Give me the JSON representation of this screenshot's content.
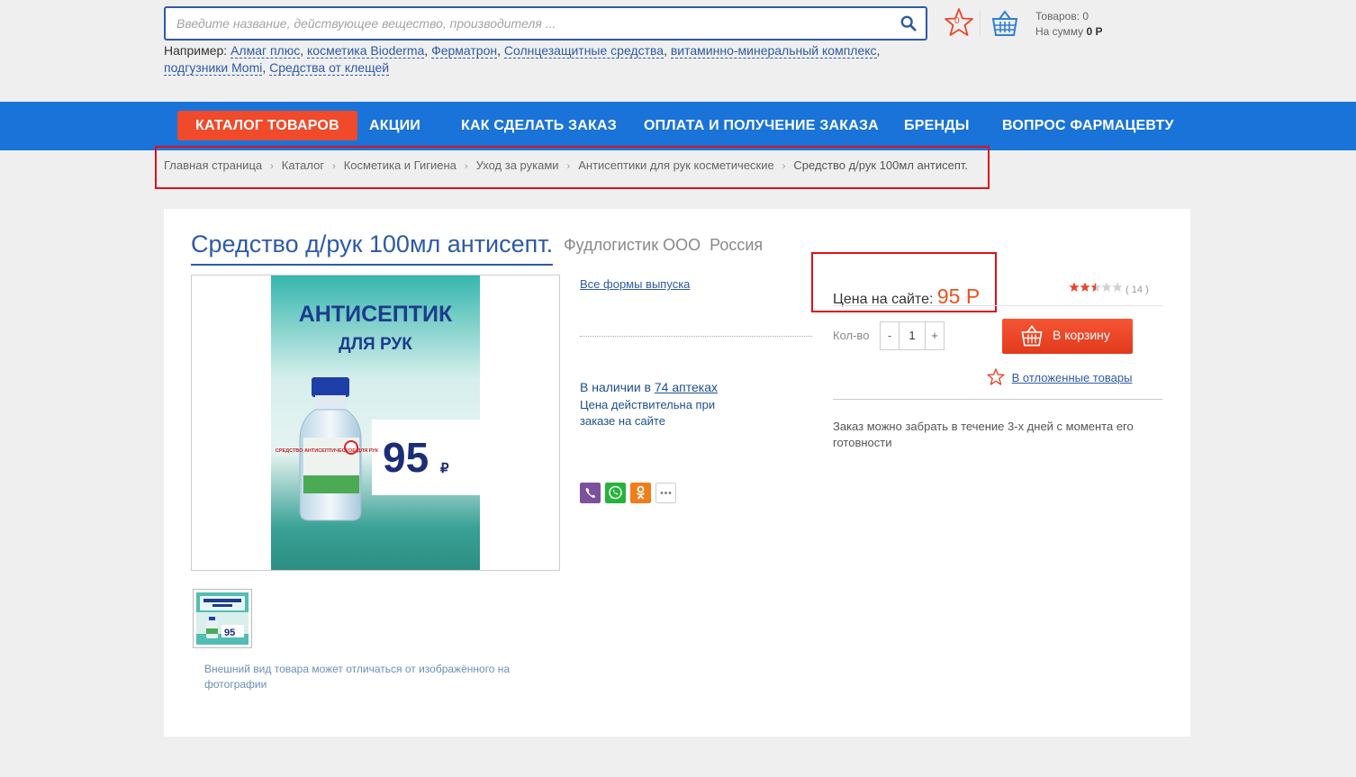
{
  "search": {
    "placeholder": "Введите название, действующее вещество, производителя ..."
  },
  "examples": {
    "prefix": "Например:",
    "items": [
      "Алмаг плюс",
      "косметика Bioderma",
      "Ферматрон",
      "Солнцезащитные средства",
      "витаминно-минеральный комплекс",
      "подгузники Momi",
      "Средства от клещей"
    ]
  },
  "header": {
    "favorites_count": "0",
    "cart_items": "Товаров: 0",
    "cart_sum_label": "На сумму",
    "cart_sum_value": "0 Р"
  },
  "nav": [
    "КАТАЛОГ ТОВАРОВ",
    "АКЦИИ",
    "КАК СДЕЛАТЬ ЗАКАЗ",
    "ОПЛАТА И ПОЛУЧЕНИЕ ЗАКАЗА",
    "БРЕНДЫ",
    "ВОПРОС ФАРМАЦЕВТУ"
  ],
  "breadcrumb": [
    "Главная страница",
    "Каталог",
    "Косметика и Гигиена",
    "Уход за руками",
    "Антисептики для рук косметические",
    "Средство д/рук 100мл антисепт."
  ],
  "product": {
    "title": "Средство д/рук 100мл антисепт.",
    "manufacturer": "Фудлогистик ООО",
    "country": "Россия",
    "image_text_line1": "АНТИСЕПТИК",
    "image_text_line2": "ДЛЯ РУК",
    "image_price": "95",
    "image_currency": "₽",
    "image_bottle_label": "СРЕДСТВО АНТИСЕПТИЧЕСКОЕ ДЛЯ РУК",
    "thumb_price": "95",
    "disclaimer": "Внешний вид товара может отличаться от изображённого на фотографии",
    "all_forms_link": "Все формы выпуска",
    "stock_prefix": "В наличии в",
    "stock_link": "74 аптеках",
    "stock_note": "Цена действительна при заказе на сайте",
    "price_label": "Цена на сайте:",
    "price_value": "95 Р",
    "rating": 2.5,
    "rating_count": "( 14 )",
    "qty_label": "Кол-во",
    "qty_minus": "-",
    "qty_value": "1",
    "qty_plus": "+",
    "cart_button": "В корзину",
    "deferred_link": "В отложенные товары",
    "pickup_note": "Заказ можно забрать в течение 3-х дней с момента его готовности"
  },
  "colors": {
    "brand_blue": "#1a73d9",
    "accent_red": "#f04a2a",
    "price_orange": "#f0501e",
    "highlight_red": "#e0101a"
  },
  "share": [
    "viber-icon",
    "whatsapp-icon",
    "odnoklassniki-icon",
    "more-icon"
  ]
}
